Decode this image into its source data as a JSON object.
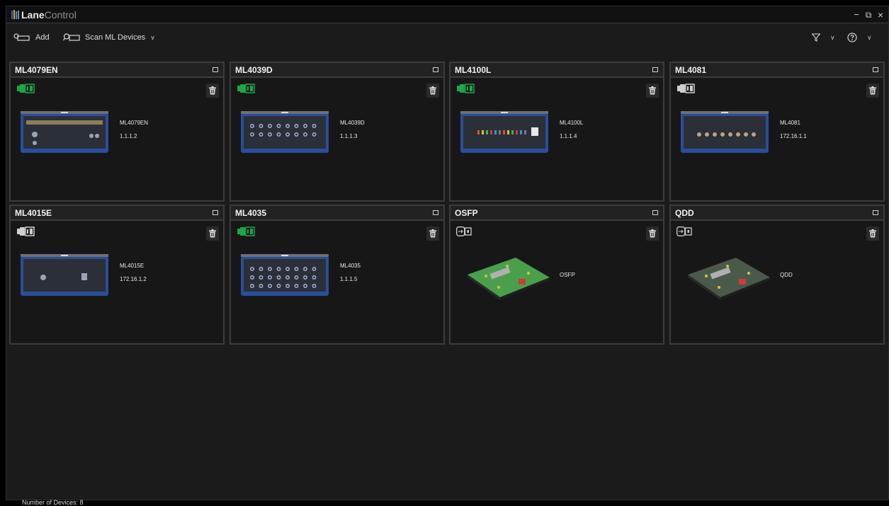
{
  "app": {
    "title_bold": "Lane",
    "title_light": "Control",
    "minimize": "−",
    "restore": "⧉",
    "close": "×"
  },
  "toolbar": {
    "add_label": "Add",
    "scan_label": "Scan ML Devices"
  },
  "colors": {
    "connected": "#1fa54a",
    "disconnected": "#cfcfcf"
  },
  "devices": [
    {
      "title": "ML4079EN",
      "name": "ML4079EN",
      "address": "1.1.1.2",
      "connection": "ethernet",
      "connected": true,
      "image": "chassis-ml4079en"
    },
    {
      "title": "ML4039D",
      "name": "ML4039D",
      "address": "1.1.1.3",
      "connection": "ethernet",
      "connected": true,
      "image": "chassis-ml4039d"
    },
    {
      "title": "ML4100L",
      "name": "ML4100L",
      "address": "1.1.1.4",
      "connection": "ethernet",
      "connected": true,
      "image": "chassis-ml4100l"
    },
    {
      "title": "ML4081",
      "name": "ML4081",
      "address": "172.16.1.1",
      "connection": "ethernet",
      "connected": false,
      "image": "chassis-ml4081"
    },
    {
      "title": "ML4015E",
      "name": "ML4015E",
      "address": "172.16.1.2",
      "connection": "ethernet",
      "connected": false,
      "image": "chassis-ml4015e"
    },
    {
      "title": "ML4035",
      "name": "ML4035",
      "address": "1.1.1.5",
      "connection": "ethernet",
      "connected": true,
      "image": "chassis-ml4035"
    },
    {
      "title": "OSFP",
      "name": "OSFP",
      "address": "",
      "connection": "usb",
      "connected": false,
      "image": "pcb-osfp"
    },
    {
      "title": "QDD",
      "name": "QDD",
      "address": "",
      "connection": "usb",
      "connected": false,
      "image": "pcb-qdd"
    }
  ],
  "status": {
    "device_count": "Number of Devices: 8"
  }
}
